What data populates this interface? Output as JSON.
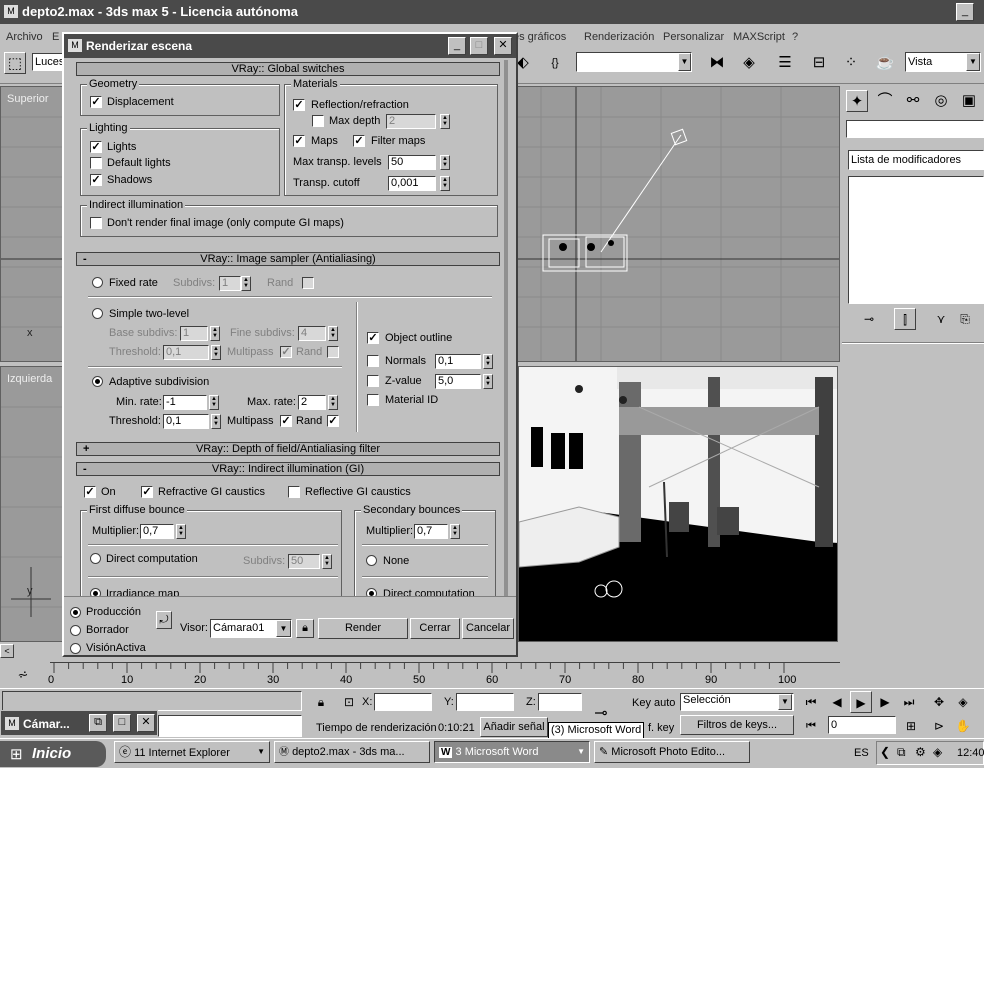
{
  "app": {
    "title": "depto2.max - 3ds max 5 - Licencia autónoma",
    "menu": [
      "Archivo",
      "E",
      "es gráficos",
      "Renderización",
      "Personalizar",
      "MAXScript",
      "?"
    ],
    "toolbar_layer_field": "Luces",
    "view_dropdown": "Vista"
  },
  "viewports": {
    "top_label": "Superior",
    "left_label": "Izquierda",
    "axis_x": "x",
    "axis_y": "y"
  },
  "command_panel": {
    "modifier_list": "Lista de modificadores"
  },
  "dialog": {
    "title": "Renderizar escena",
    "global_switches_title": "VRay:: Global switches",
    "geometry": {
      "title": "Geometry",
      "displacement": "Displacement"
    },
    "materials": {
      "title": "Materials",
      "reflection_refraction": "Reflection/refraction",
      "max_depth_label": "Max depth",
      "max_depth_value": "2",
      "maps": "Maps",
      "filter_maps": "Filter maps",
      "max_transp_label": "Max transp. levels",
      "max_transp_value": "50",
      "transp_cutoff_label": "Transp. cutoff",
      "transp_cutoff_value": "0,001"
    },
    "lighting": {
      "title": "Lighting",
      "lights": "Lights",
      "default_lights": "Default lights",
      "shadows": "Shadows"
    },
    "indirect": {
      "title": "Indirect illumination",
      "dont_render": "Don't render final image (only compute GI maps)"
    },
    "image_sampler_title": "VRay:: Image sampler (Antialiasing)",
    "sampler": {
      "fixed_rate": "Fixed rate",
      "subdivs_label": "Subdivs:",
      "subdivs_value": "1",
      "rand": "Rand",
      "simple_two_level": "Simple two-level",
      "base_subdivs_label": "Base subdivs:",
      "base_subdivs_value": "1",
      "fine_subdivs_label": "Fine subdivs:",
      "fine_subdivs_value": "4",
      "threshold_label": "Threshold:",
      "threshold_value_1": "0,1",
      "multipass": "Multipass",
      "adaptive_subdivision": "Adaptive subdivision",
      "min_rate_label": "Min. rate:",
      "min_rate_value": "-1",
      "max_rate_label": "Max. rate:",
      "max_rate_value": "2",
      "threshold_value_2": "0,1",
      "object_outline": "Object outline",
      "normals": "Normals",
      "normals_value": "0,1",
      "z_value": "Z-value",
      "z_value_value": "5,0",
      "material_id": "Material ID"
    },
    "dof_title": "VRay:: Depth of field/Antialiasing filter",
    "gi_title": "VRay:: Indirect illumination (GI)",
    "gi": {
      "on": "On",
      "refractive": "Refractive GI caustics",
      "reflective": "Reflective GI caustics",
      "first_bounce": "First diffuse bounce",
      "multiplier_label": "Multiplier:",
      "multiplier_1": "0,7",
      "direct_computation": "Direct computation",
      "subdivs_label": "Subdivs:",
      "subdivs_value": "50",
      "irradiance_map": "Irradiance map",
      "secondary_bounces": "Secondary bounces",
      "multiplier_2": "0,7",
      "none": "None",
      "direct_computation_2": "Direct computation"
    },
    "footer": {
      "produccion": "Producción",
      "borrador": "Borrador",
      "vision_activa": "VisiónActiva",
      "visor_label": "Visor:",
      "visor_value": "Cámara01",
      "render": "Render",
      "cerrar": "Cerrar",
      "cancelar": "Cancelar"
    }
  },
  "timeline": {
    "ticks": [
      "0",
      "10",
      "20",
      "30",
      "40",
      "50",
      "60",
      "70",
      "80",
      "90",
      "100"
    ]
  },
  "status": {
    "camera_window": "Cámar...",
    "x_label": "X:",
    "y_label": "Y:",
    "z_label": "Z:",
    "key_auto": "Key auto",
    "selection": "Selección",
    "render_time_label": "Tiempo de renderización",
    "render_time_value": "0:10:21",
    "add_signal": "Añadir señal",
    "set_key": "f. key",
    "filters": "Filtros de keys...",
    "frame_value": "0",
    "tooltip": "(3) Microsoft Word"
  },
  "taskbar": {
    "start": "Inicio",
    "tasks": [
      "11 Internet Explorer",
      "depto2.max - 3ds ma...",
      "3 Microsoft Word",
      "Microsoft Photo Edito..."
    ],
    "lang": "ES",
    "clock": "12:40"
  }
}
